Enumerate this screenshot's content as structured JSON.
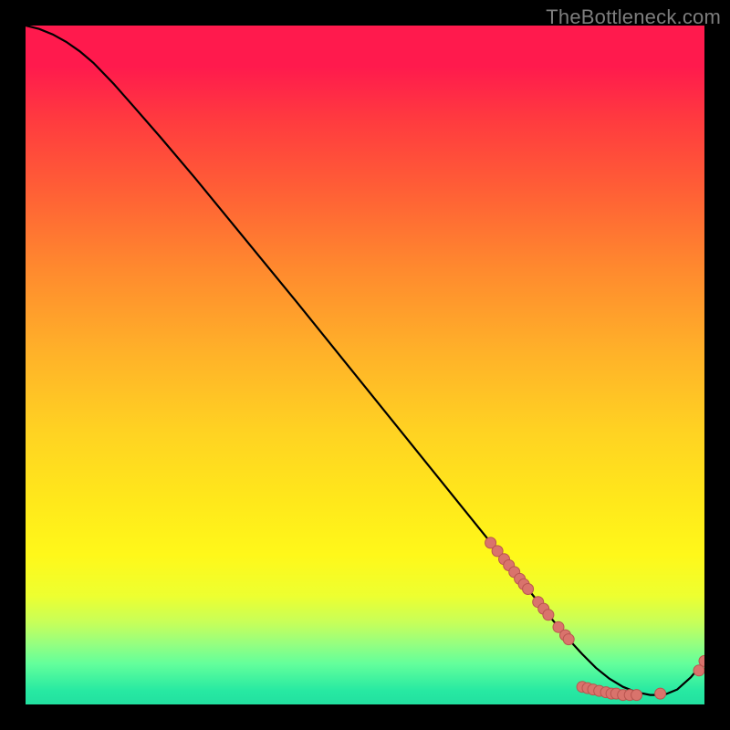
{
  "watermark": "TheBottleneck.com",
  "colors": {
    "page_bg": "#000000",
    "curve": "#000000",
    "marker_fill": "#d9736c",
    "marker_stroke": "#b9544f",
    "gradient_top": "#ff1a4d",
    "gradient_bottom": "#22e0a0"
  },
  "chart_data": {
    "type": "line",
    "title": "",
    "xlabel": "",
    "ylabel": "",
    "xlim": [
      0,
      100
    ],
    "ylim": [
      0,
      100
    ],
    "grid": false,
    "series": [
      {
        "name": "bottleneck-curve",
        "x": [
          0,
          2,
          4,
          6,
          8,
          10,
          13,
          16,
          20,
          25,
          30,
          35,
          40,
          45,
          50,
          55,
          60,
          65,
          70,
          74,
          77,
          80,
          82,
          84,
          86,
          88,
          90,
          92,
          94,
          96,
          98,
          100
        ],
        "y": [
          100,
          99.5,
          98.7,
          97.6,
          96.2,
          94.5,
          91.4,
          88.0,
          83.4,
          77.5,
          71.4,
          65.3,
          59.2,
          53.0,
          46.8,
          40.6,
          34.4,
          28.2,
          22.0,
          17.0,
          13.2,
          9.6,
          7.4,
          5.4,
          3.8,
          2.6,
          1.8,
          1.4,
          1.4,
          2.2,
          4.0,
          6.4
        ]
      }
    ],
    "scatter_points": [
      {
        "x": 68.5,
        "y": 23.8
      },
      {
        "x": 69.5,
        "y": 22.6
      },
      {
        "x": 70.5,
        "y": 21.4
      },
      {
        "x": 71.2,
        "y": 20.5
      },
      {
        "x": 72.0,
        "y": 19.5
      },
      {
        "x": 72.8,
        "y": 18.5
      },
      {
        "x": 73.4,
        "y": 17.7
      },
      {
        "x": 74.0,
        "y": 17.0
      },
      {
        "x": 75.5,
        "y": 15.1
      },
      {
        "x": 76.3,
        "y": 14.1
      },
      {
        "x": 77.0,
        "y": 13.2
      },
      {
        "x": 78.5,
        "y": 11.4
      },
      {
        "x": 79.5,
        "y": 10.2
      },
      {
        "x": 80.0,
        "y": 9.6
      },
      {
        "x": 82.0,
        "y": 2.6
      },
      {
        "x": 82.8,
        "y": 2.4
      },
      {
        "x": 83.6,
        "y": 2.2
      },
      {
        "x": 84.5,
        "y": 2.0
      },
      {
        "x": 85.5,
        "y": 1.8
      },
      {
        "x": 86.3,
        "y": 1.6
      },
      {
        "x": 87.0,
        "y": 1.6
      },
      {
        "x": 88.0,
        "y": 1.4
      },
      {
        "x": 89.0,
        "y": 1.4
      },
      {
        "x": 90.0,
        "y": 1.4
      },
      {
        "x": 93.5,
        "y": 1.6
      },
      {
        "x": 99.2,
        "y": 5.0
      },
      {
        "x": 100.0,
        "y": 6.4
      }
    ]
  }
}
